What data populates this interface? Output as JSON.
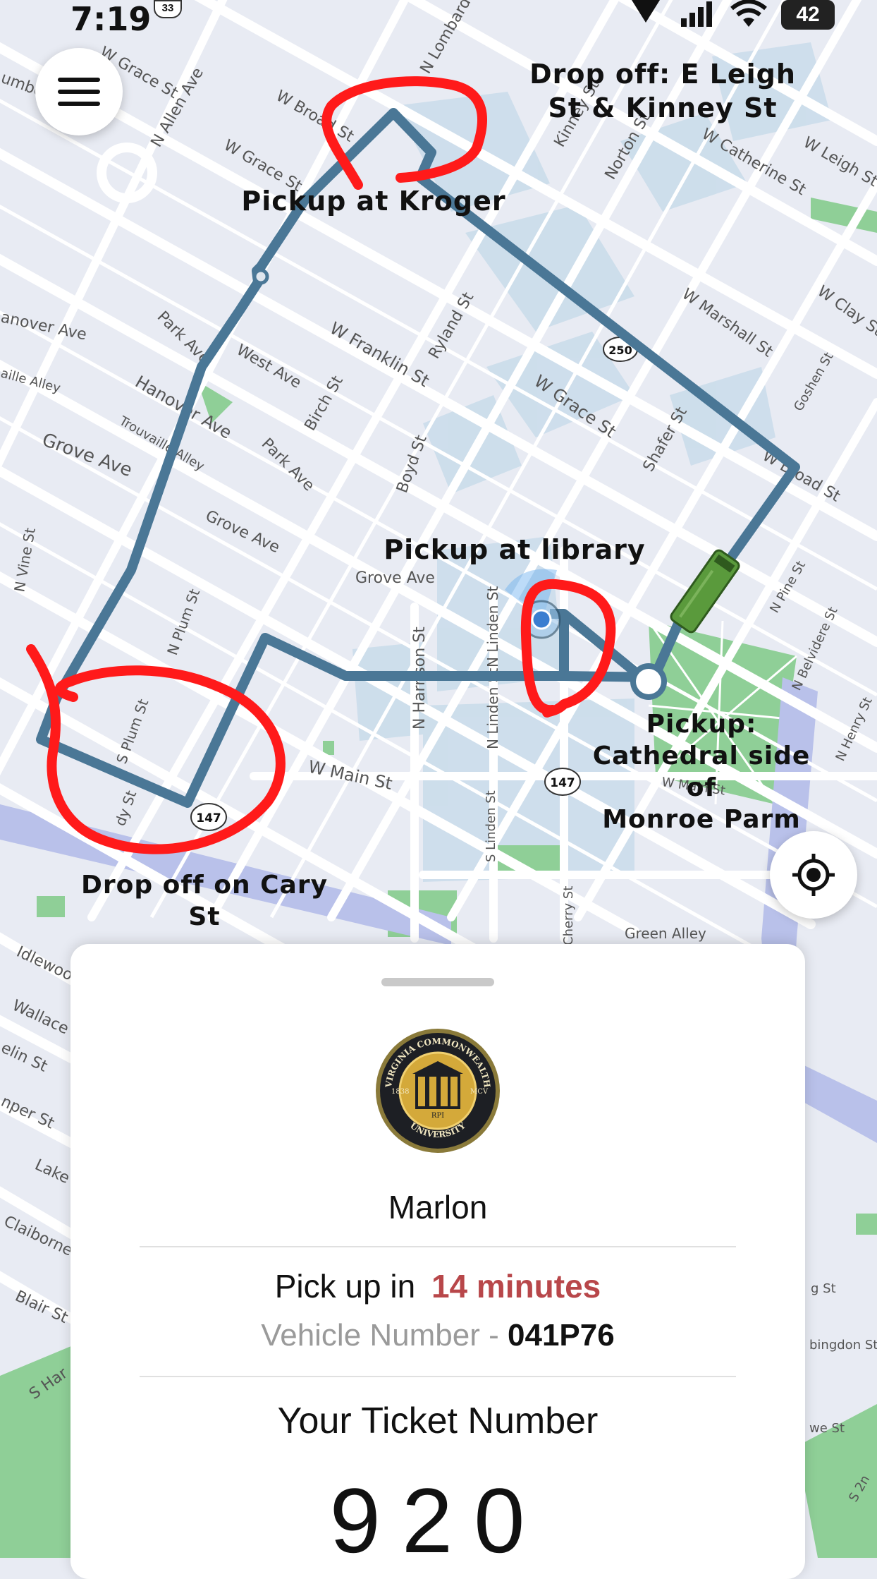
{
  "status_bar": {
    "time": "7:19",
    "route_badge": "33",
    "battery": "42"
  },
  "map": {
    "streets": {
      "w_grace_st_1": "W Grace St",
      "n_allen_ave": "N Allen Ave",
      "w_broad_st": "W Broad St",
      "n_lombardy": "N Lombardo",
      "w_grace_st_2": "W Grace St",
      "anover_ave": "anover Ave",
      "aille_alley": "aille Alley",
      "park_ave_1": "Park Ave",
      "west_ave": "West Ave",
      "w_franklin_st": "W Franklin St",
      "ryland_st": "Ryland St",
      "hanover_ave": "Hanover Ave",
      "trouvaille_alley": "Trouvaille Alley",
      "grove_ave_1": "Grove Ave",
      "birch_st": "Birch St",
      "park_ave_2": "Park Ave",
      "boyd_st": "Boyd St",
      "grove_ave_2": "Grove Ave",
      "grove_ave_3": "Grove Ave",
      "n_vine_st": "N Vine St",
      "n_plum_st": "N Plum St",
      "s_plum_st": "S Plum St",
      "n_harrison_st": "N Harrison St",
      "n_linden_st_1": "N Linden St",
      "n_linden_st_2": "N Linden St",
      "w_main_st": "W Main St",
      "s_linden_st": "S Linden St",
      "cherry_st": "Cherry St",
      "green_alley": "Green Alley",
      "w_marshall_st": "W Marshall St",
      "w_grace_st_3": "W Grace St",
      "shafer_st": "Shafer St",
      "w_broad_st_2": "W Broad St",
      "w_clay_st": "W Clay St",
      "goshen_st": "Goshen St",
      "n_pine_st": "N Pine St",
      "n_belvidere_st": "N Belvidere St",
      "n_henry_st": "N Henry St",
      "w_catherine_st": "W Catherine St",
      "w_leigh_st": "W Leigh St",
      "norton_st": "Norton St",
      "kinney_st": "Kinney St",
      "idlewood": "Idlewood",
      "wallace": "Wallace",
      "elin_st": "elin St",
      "juniper_st": "nper St",
      "lake": "Lake",
      "claiborne": "Claiborne",
      "blair_st": "Blair St",
      "s_harrison": "S Har",
      "abingdon": "bingdon St",
      "g_st": "g St",
      "we_st": "we St",
      "s_2nd": "S 2n",
      "w_main_2": "W Main St",
      "dy_st": "dy St",
      "umber": "umber"
    },
    "shields": [
      "147",
      "147",
      "250",
      "33"
    ]
  },
  "annotations": {
    "drop_off_leigh_line1": "Drop off: E Leigh",
    "drop_off_leigh_line2": "St & Kinney St",
    "pickup_kroger": "Pickup at Kroger",
    "pickup_library": "Pickup at library",
    "pickup_cathedral_line1": "Pickup:",
    "pickup_cathedral_line2": "Cathedral side of",
    "pickup_cathedral_line3": "Monroe Parm",
    "drop_off_cary_line1": "Drop off on Cary",
    "drop_off_cary_line2": "St"
  },
  "colors": {
    "route": "#4a7796",
    "annotation_red": "#ff1a1a",
    "vehicle": "#5a9a3c",
    "minutes_accent": "#b8474a",
    "map_background": "#e8ebf3",
    "park_green": "#8fcf97",
    "campus_blue": "#c9dcea"
  },
  "icons": {
    "menu": "hamburger-menu-icon",
    "locate": "crosshair-locate-icon",
    "vehicle": "bus-icon"
  },
  "card": {
    "logo_text_top": "VIRGINIA COMMONWEALTH",
    "logo_text_bottom": "UNIVERSITY",
    "logo_left": "1838",
    "logo_right": "MCV",
    "logo_center": "RPI",
    "driver_name": "Marlon",
    "pickup_prefix": "Pick up in",
    "pickup_minutes": "14 minutes",
    "vehicle_label": "Vehicle Number - ",
    "vehicle_number": "041P76",
    "ticket_label": "Your Ticket Number",
    "ticket_number": "920"
  }
}
